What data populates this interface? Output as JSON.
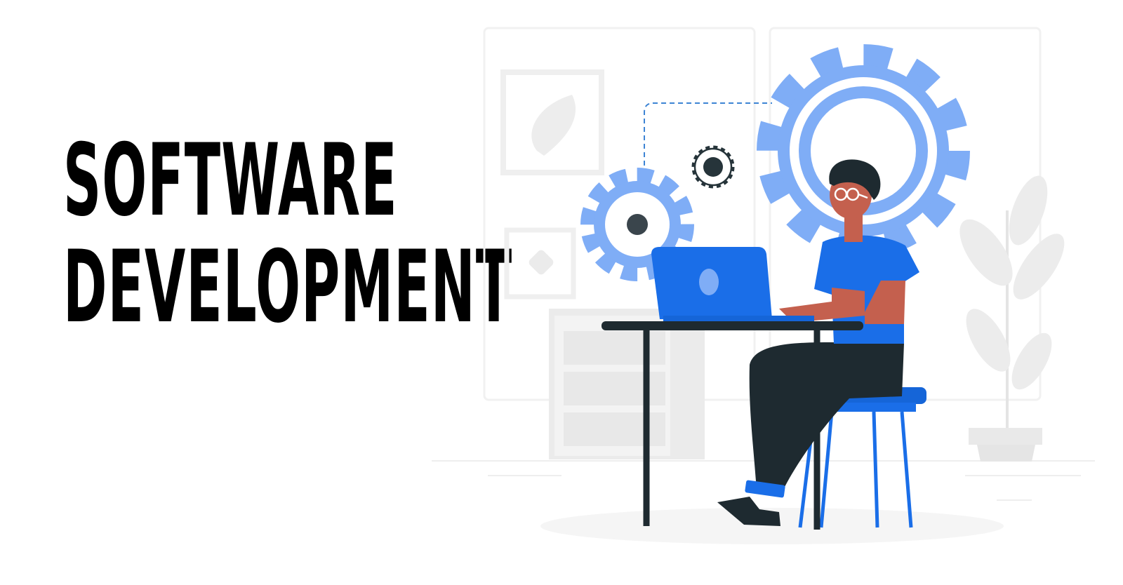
{
  "headline": {
    "line1": "SOFTWARE",
    "line2": "DEVELOPMENT"
  },
  "colors": {
    "text": "#000000",
    "accent_blue": "#1a6ee8",
    "gear_blue": "#7fadf6",
    "dark": "#1e2a30",
    "skin": "#c4604e",
    "light_gray": "#ebebeb",
    "background": "#ffffff"
  },
  "icons": [
    "gear-icon",
    "laptop-icon",
    "plant-icon",
    "picture-frame-icon"
  ]
}
